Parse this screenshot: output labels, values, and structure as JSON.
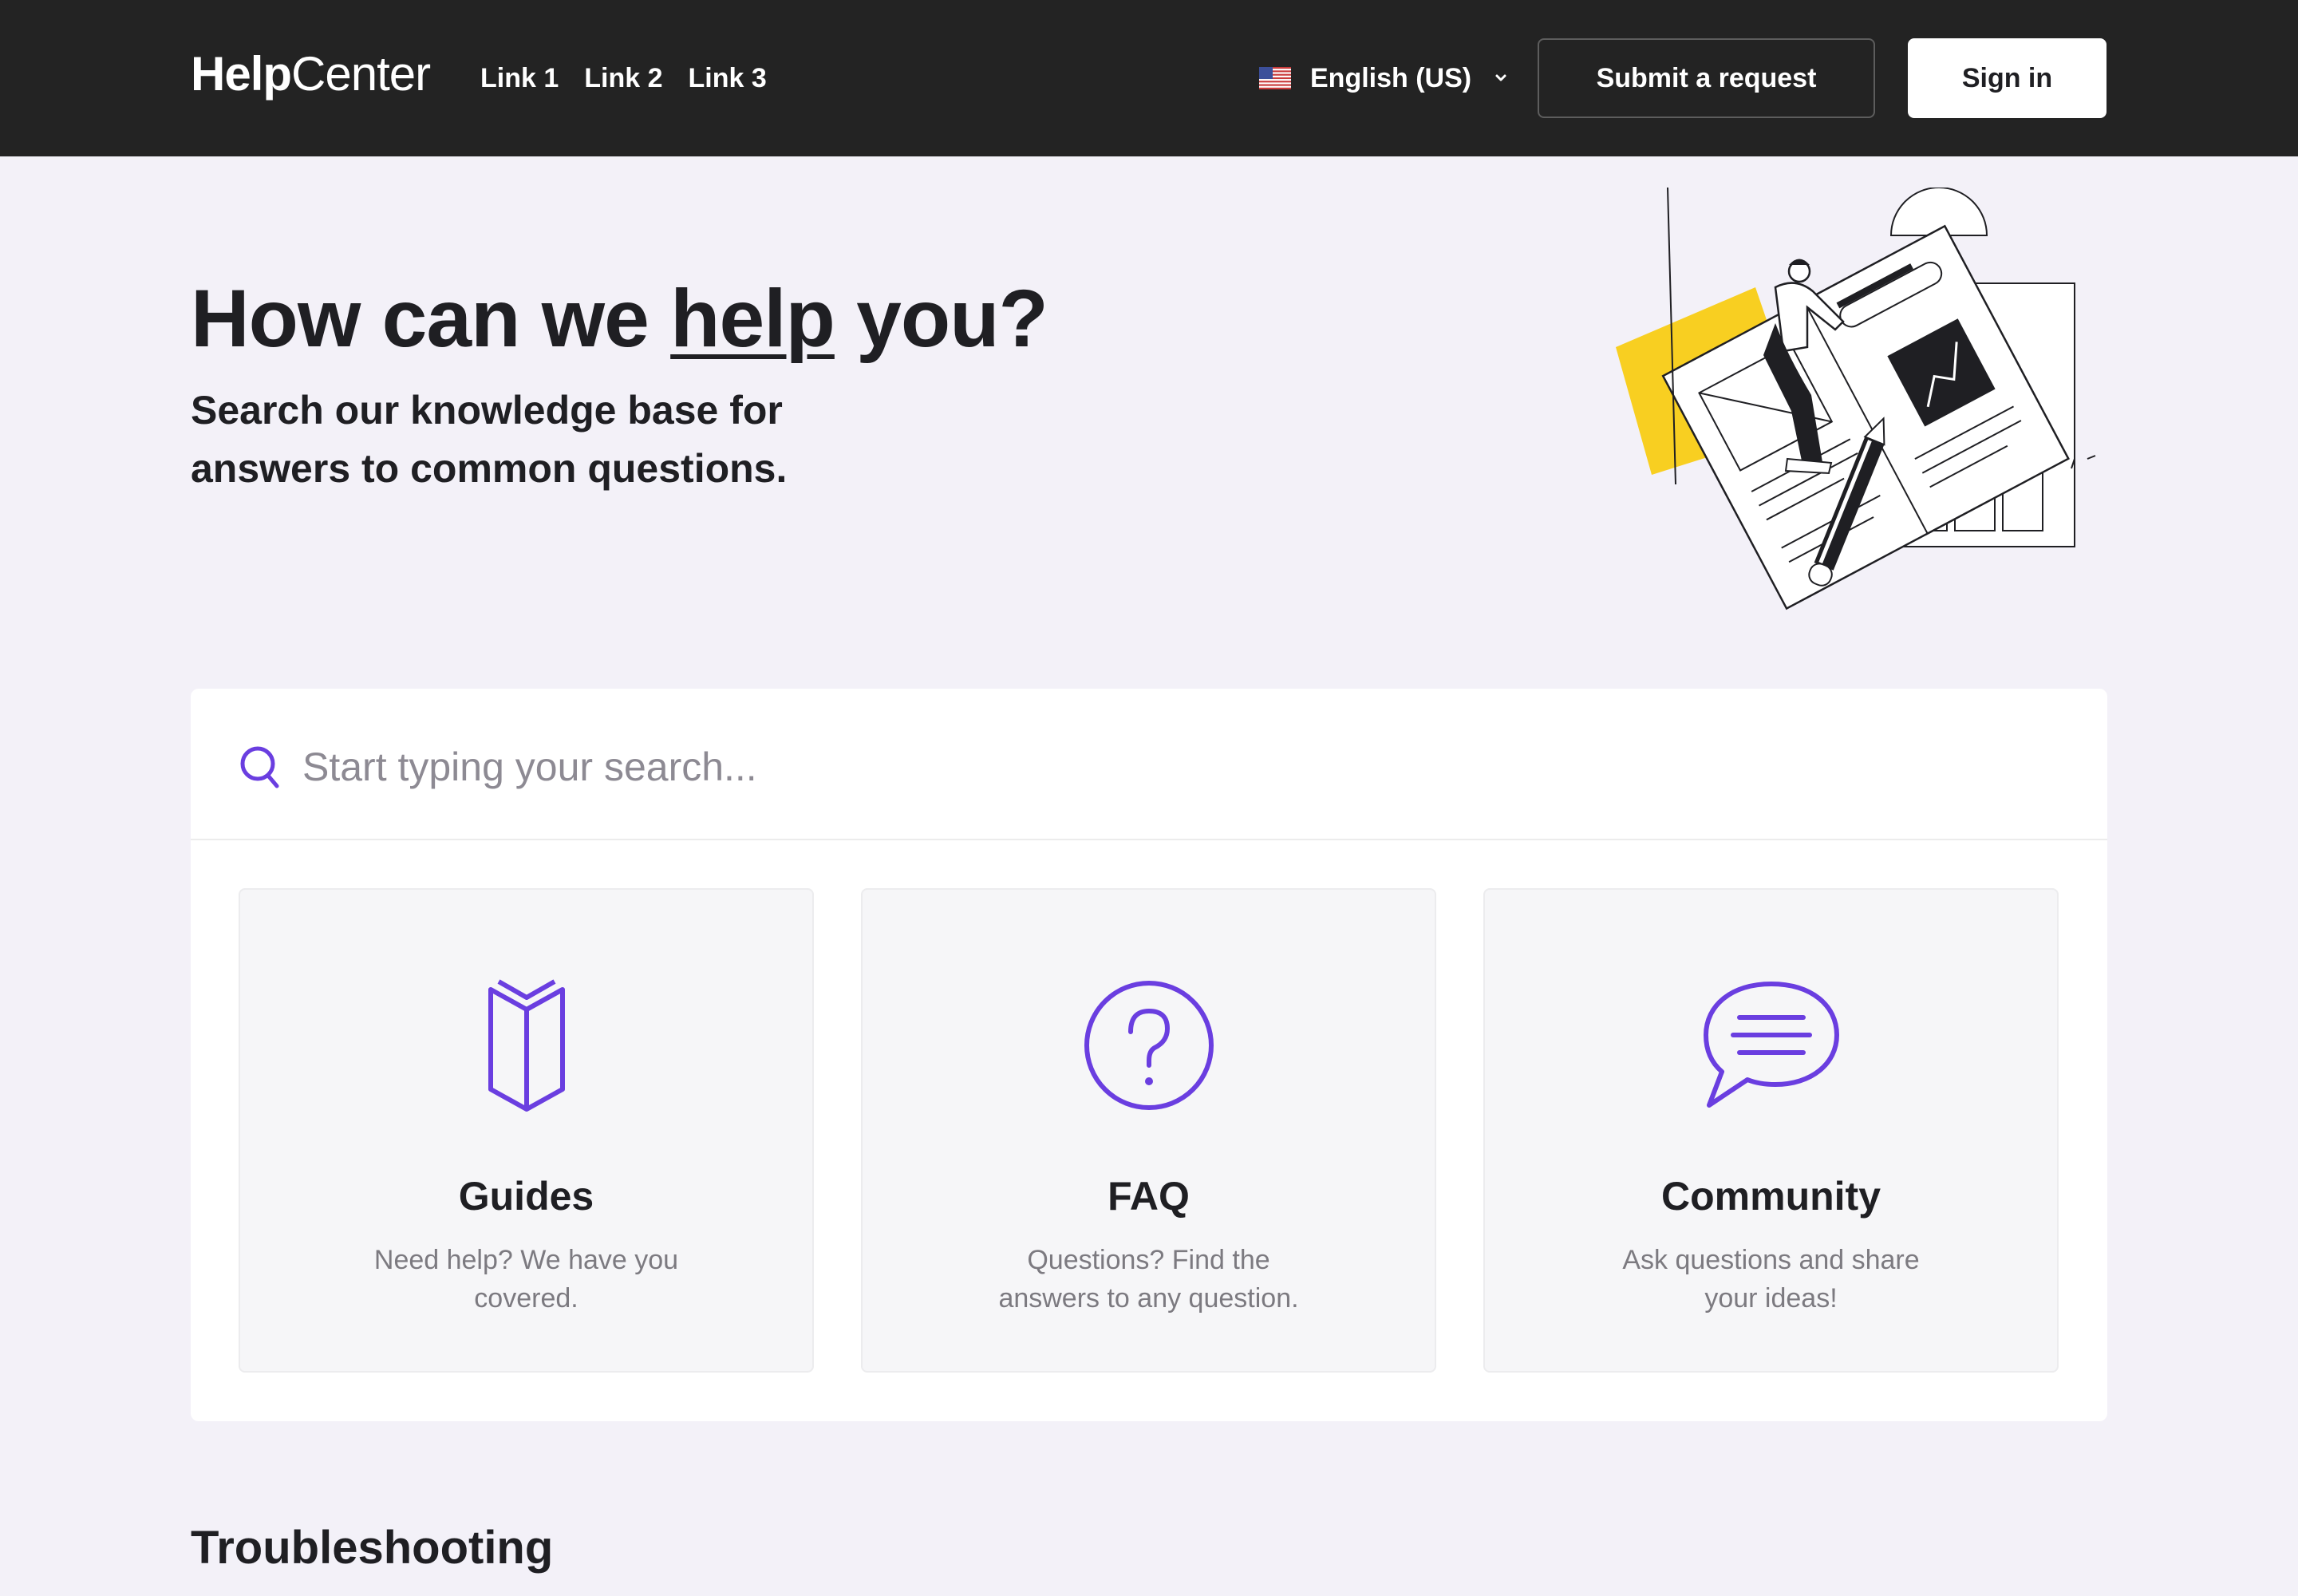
{
  "header": {
    "logo_bold": "Help",
    "logo_light": "Center",
    "nav": [
      "Link 1",
      "Link 2",
      "Link 3"
    ],
    "language": "English (US)",
    "submit_label": "Submit a request",
    "signin_label": "Sign in"
  },
  "hero": {
    "title_before": "How can we ",
    "title_emphasis": "help",
    "title_after": " you?",
    "subtitle_line1": "Search our knowledge base for",
    "subtitle_line2": "answers to common questions."
  },
  "search": {
    "placeholder": "Start typing your search..."
  },
  "cards": [
    {
      "icon": "book-icon",
      "title": "Guides",
      "description": "Need help? We have you covered."
    },
    {
      "icon": "question-circle-icon",
      "title": "FAQ",
      "description": "Questions? Find the answers to any question."
    },
    {
      "icon": "chat-bubble-icon",
      "title": "Community",
      "description": "Ask questions and share your ideas!"
    }
  ],
  "sections": {
    "troubleshooting": "Troubleshooting"
  },
  "colors": {
    "accent": "#6a3ee0",
    "header_bg": "#232323",
    "page_bg": "#f3f1f8",
    "illustration_yellow": "#f8cf21"
  }
}
